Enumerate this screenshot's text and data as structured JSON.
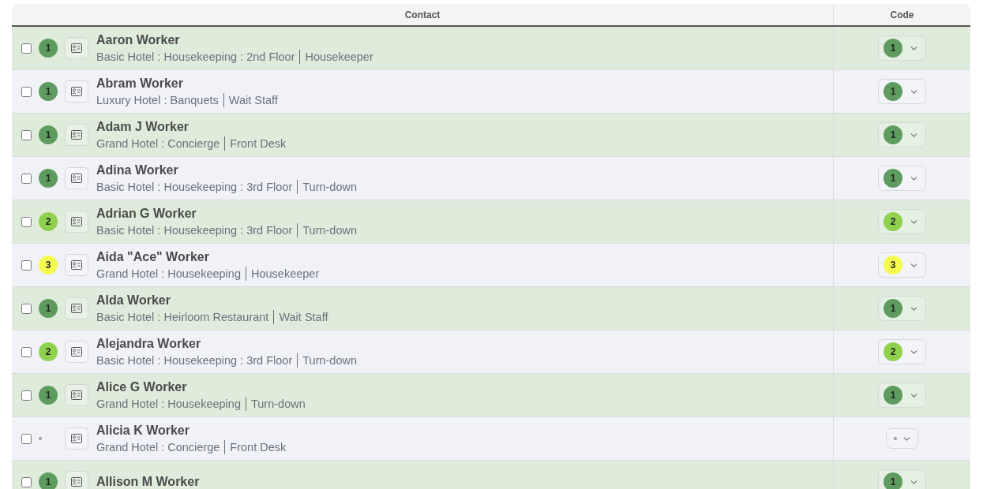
{
  "table": {
    "columns": [
      "Contact",
      "Code"
    ],
    "rows": [
      {
        "checked": false,
        "kind": "coded",
        "badge": "1",
        "color": "#5e9b5e",
        "name": "Aaron Worker",
        "location": "Basic Hotel : Housekeeping : 2nd Floor",
        "role": "Housekeeper",
        "code": "1"
      },
      {
        "checked": false,
        "kind": "coded",
        "badge": "1",
        "color": "#5e9b5e",
        "name": "Abram Worker",
        "location": "Luxury Hotel : Banquets",
        "role": "Wait Staff",
        "code": "1"
      },
      {
        "checked": false,
        "kind": "coded",
        "badge": "1",
        "color": "#5e9b5e",
        "name": "Adam J Worker",
        "location": "Grand Hotel : Concierge",
        "role": "Front Desk",
        "code": "1"
      },
      {
        "checked": false,
        "kind": "coded",
        "badge": "1",
        "color": "#5e9b5e",
        "name": "Adina Worker",
        "location": "Basic Hotel : Housekeeping : 3rd Floor",
        "role": "Turn-down",
        "code": "1"
      },
      {
        "checked": false,
        "kind": "coded",
        "badge": "2",
        "color": "#8fd14f",
        "name": "Adrian G Worker",
        "location": "Basic Hotel : Housekeeping : 3rd Floor",
        "role": "Turn-down",
        "code": "2"
      },
      {
        "checked": false,
        "kind": "coded",
        "badge": "3",
        "color": "#f5fa4f",
        "name": "Aida \"Ace\" Worker",
        "location": "Grand Hotel : Housekeeping",
        "role": "Housekeeper",
        "code": "3"
      },
      {
        "checked": false,
        "kind": "coded",
        "badge": "1",
        "color": "#5e9b5e",
        "name": "Alda Worker",
        "location": "Basic Hotel : Heirloom Restaurant",
        "role": "Wait Staff",
        "code": "1"
      },
      {
        "checked": false,
        "kind": "coded",
        "badge": "2",
        "color": "#8fd14f",
        "name": "Alejandra Worker",
        "location": "Basic Hotel : Housekeeping : 3rd Floor",
        "role": "Turn-down",
        "code": "2"
      },
      {
        "checked": false,
        "kind": "coded",
        "badge": "1",
        "color": "#5e9b5e",
        "name": "Alice G Worker",
        "location": "Grand Hotel : Housekeeping",
        "role": "Turn-down",
        "code": "1"
      },
      {
        "checked": false,
        "kind": "uncoded",
        "name": "Alicia K Worker",
        "location": "Grand Hotel : Concierge",
        "role": "Front Desk"
      },
      {
        "checked": false,
        "kind": "coded",
        "badge": "1",
        "color": "#5e9b5e",
        "name": "Allison M Worker",
        "code": "1"
      }
    ]
  }
}
